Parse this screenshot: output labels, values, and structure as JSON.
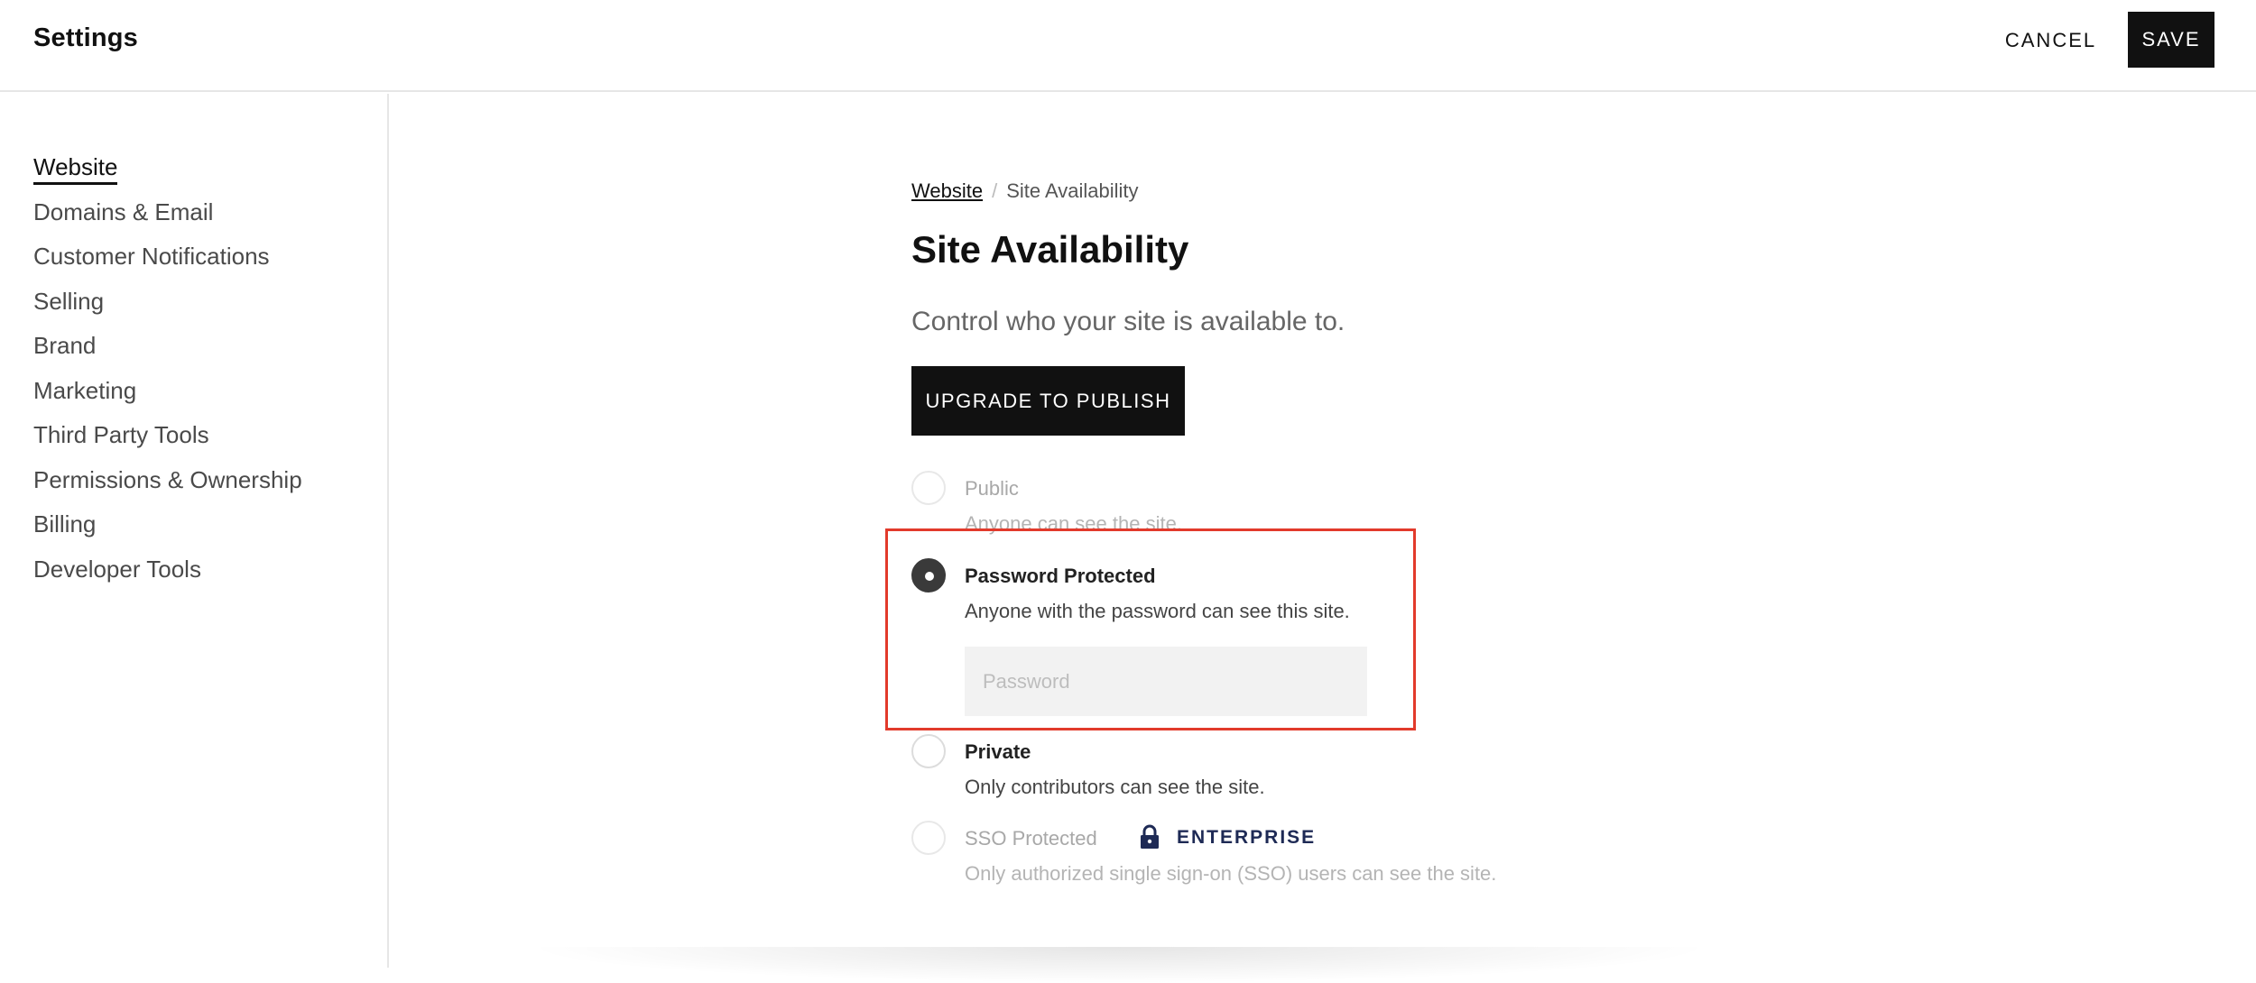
{
  "header": {
    "title": "Settings",
    "cancel_label": "CANCEL",
    "save_label": "SAVE"
  },
  "sidebar": {
    "items": [
      {
        "label": "Website",
        "active": true
      },
      {
        "label": "Domains & Email"
      },
      {
        "label": "Customer Notifications"
      },
      {
        "label": "Selling"
      },
      {
        "label": "Brand"
      },
      {
        "label": "Marketing"
      },
      {
        "label": "Third Party Tools"
      },
      {
        "label": "Permissions & Ownership"
      },
      {
        "label": "Billing"
      },
      {
        "label": "Developer Tools"
      }
    ]
  },
  "main": {
    "breadcrumb": {
      "parent": "Website",
      "separator": "/",
      "current": "Site Availability"
    },
    "title": "Site Availability",
    "subtitle": "Control who your site is available to.",
    "upgrade_label": "UPGRADE TO PUBLISH",
    "options": [
      {
        "label": "Public",
        "desc": "Anyone can see the site.",
        "selected": false
      },
      {
        "label": "Password Protected",
        "desc": "Anyone with the password can see this site.",
        "selected": true
      },
      {
        "label": "Private",
        "desc": "Only contributors can see the site.",
        "selected": false
      },
      {
        "label": "SSO Protected",
        "desc": "Only authorized single sign-on (SSO) users can see the site.",
        "selected": false,
        "badge": "ENTERPRISE"
      }
    ],
    "password": {
      "placeholder": "Password",
      "value": ""
    }
  },
  "colors": {
    "accent": "#111111",
    "highlight": "#e23a2b",
    "enterprise": "#1e2a55"
  },
  "icons": {
    "lock": "lock-icon"
  }
}
